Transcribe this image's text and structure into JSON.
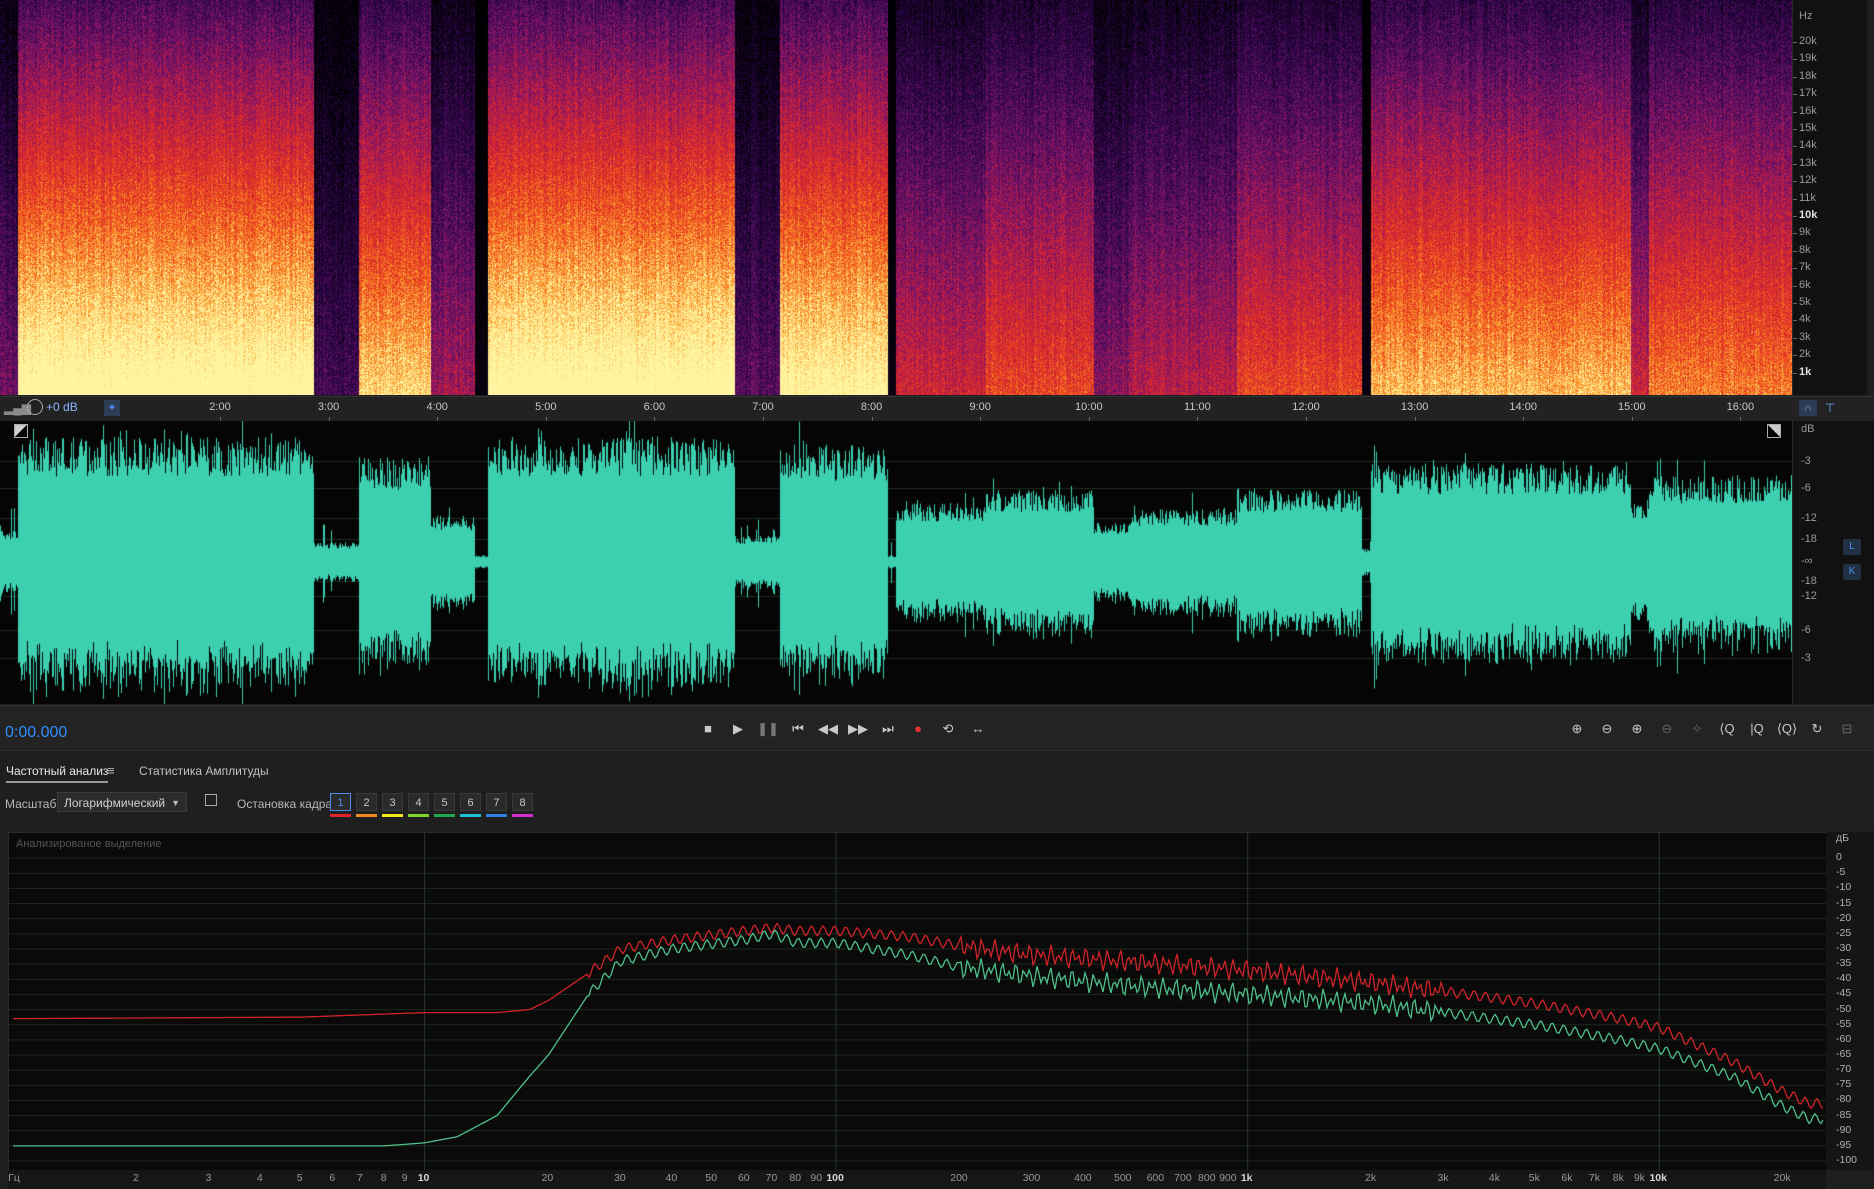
{
  "spectrogram": {
    "unit_label": "Hz",
    "freq_labels": [
      "20k",
      "19k",
      "18k",
      "17k",
      "16k",
      "15k",
      "14k",
      "13k",
      "12k",
      "11k",
      "10k",
      "9k",
      "8k",
      "7k",
      "6k",
      "5k",
      "4k",
      "3k",
      "2k",
      "1k"
    ]
  },
  "timeline": {
    "gain": "+0 dB",
    "labels": [
      "2:00",
      "3:00",
      "4:00",
      "5:00",
      "6:00",
      "7:00",
      "8:00",
      "9:00",
      "10:00",
      "11:00",
      "12:00",
      "13:00",
      "14:00",
      "15:00",
      "16:00"
    ]
  },
  "waveform": {
    "unit_label": "dB",
    "db_labels": [
      "-3",
      "-6",
      "-12",
      "-18",
      "-∞",
      "-18",
      "-12",
      "-6",
      "-3"
    ],
    "channel_top": "L",
    "channel_bottom": "K",
    "fill_color": "#3ccfb0"
  },
  "transport": {
    "time": "0:00.000",
    "buttons": [
      "stop",
      "play",
      "pause",
      "to-start",
      "rewind",
      "fast-forward",
      "to-end",
      "record",
      "loop",
      "skip"
    ]
  },
  "analysis": {
    "tab_frequency": "Частотный анализ",
    "tab_amplitude": "Статистика Амплитуды",
    "scale_label": "Масштаб:",
    "scale_value": "Логарифмический",
    "freeze_label": "Остановка кадра:",
    "frames": [
      "1",
      "2",
      "3",
      "4",
      "5",
      "6",
      "7",
      "8"
    ],
    "frame_colors": [
      "#e0242a",
      "#f08a1c",
      "#f2e61a",
      "#7fd62b",
      "#21a84a",
      "#1fc1d8",
      "#2d7fe0",
      "#d62bd0"
    ],
    "caption": "Анализированое выделение"
  },
  "chart_data": {
    "type": "line",
    "xlabel": "Гц",
    "ylabel": "дБ",
    "x_scale": "log",
    "xlim": [
      1,
      25000
    ],
    "ylim": [
      -100,
      5
    ],
    "x_ticks": [
      "Гц",
      "2",
      "3",
      "4",
      "5",
      "6",
      "7",
      "8",
      "9",
      "10",
      "20",
      "30",
      "40",
      "50",
      "60",
      "70",
      "80",
      "90",
      "100",
      "200",
      "300",
      "400",
      "500",
      "600",
      "700",
      "800",
      "900",
      "1k",
      "2k",
      "3k",
      "4k",
      "5k",
      "6k",
      "7k",
      "8k",
      "9k",
      "10k",
      "20k"
    ],
    "y_ticks": [
      "дБ",
      "0",
      "-5",
      "-10",
      "-15",
      "-20",
      "-25",
      "-30",
      "-35",
      "-40",
      "-45",
      "-50",
      "-55",
      "-60",
      "-65",
      "-70",
      "-75",
      "-80",
      "-85",
      "-90",
      "-95",
      "-100"
    ],
    "series": [
      {
        "color": "#d0242a",
        "x": [
          1,
          5,
          10,
          15,
          18,
          20,
          25,
          30,
          40,
          60,
          70,
          80,
          100,
          150,
          200,
          300,
          500,
          1000,
          2000,
          3000,
          5000,
          8000,
          10000,
          15000,
          20000,
          23000
        ],
        "y": [
          -53,
          -52.5,
          -51,
          -51,
          -50,
          -47,
          -38,
          -30,
          -27,
          -24,
          -23,
          -24,
          -24,
          -26,
          -29,
          -32,
          -34,
          -37,
          -41,
          -44,
          -48,
          -53,
          -56,
          -67,
          -77,
          -81
        ]
      },
      {
        "color": "#4fbf8a",
        "x": [
          1,
          5,
          8,
          10,
          12,
          15,
          18,
          20,
          25,
          30,
          40,
          60,
          70,
          80,
          100,
          150,
          200,
          300,
          500,
          1000,
          2000,
          3000,
          5000,
          8000,
          10000,
          15000,
          20000,
          23000
        ],
        "y": [
          -95,
          -95,
          -95,
          -94,
          -92,
          -85,
          -72,
          -65,
          -45,
          -34,
          -30,
          -27,
          -25,
          -28,
          -28,
          -32,
          -36,
          -39,
          -42,
          -45,
          -48,
          -51,
          -55,
          -60,
          -63,
          -72,
          -82,
          -86
        ]
      }
    ]
  }
}
